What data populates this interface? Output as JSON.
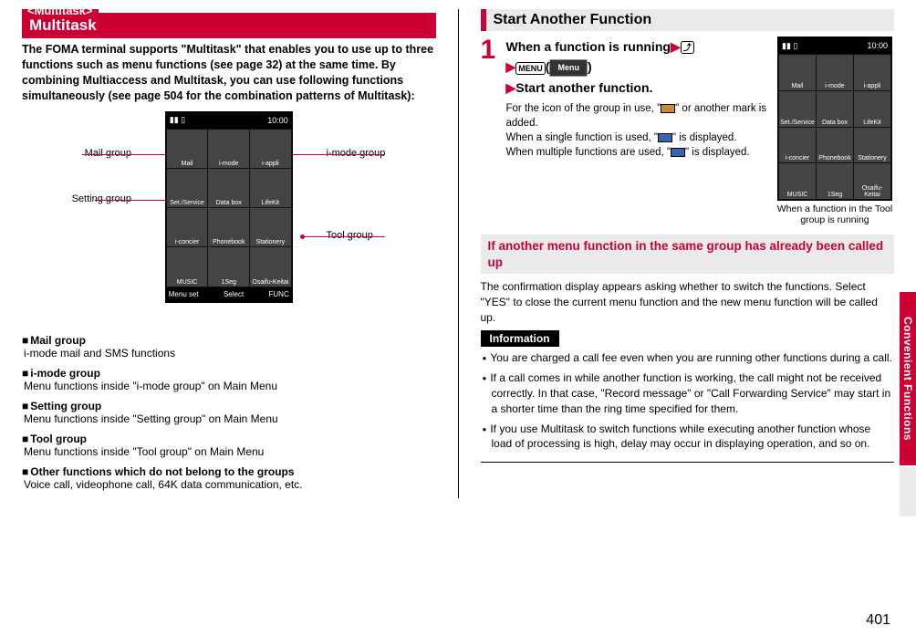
{
  "left": {
    "tag": "<Multitask>",
    "heading": "Multitask",
    "intro": "The FOMA terminal supports \"Multitask\" that enables you to use up to three functions such as menu functions (see page 32) at the same time. By combining Multiaccess and Multitask, you can use following functions simultaneously (see page 504 for the combination patterns of Multitask):",
    "labels": {
      "mail": "Mail group",
      "setting": "Setting group",
      "imode": "i-mode group",
      "tool": "Tool group"
    },
    "phone": {
      "sig": "▮▮ ▯",
      "time": "10:00",
      "cells": [
        "Mail",
        "i-mode",
        "i-appli",
        "Set./Service",
        "Data box",
        "LifeKit",
        "i-concier",
        "Phonebook",
        "Stationery",
        "MUSIC",
        "1Seg",
        "Osaifu-Keitai"
      ],
      "soft_l": "Menu set",
      "soft_c": "Select",
      "soft_r": "FUNC"
    },
    "groups": [
      {
        "title": "Mail group",
        "desc": "i-mode mail and SMS functions"
      },
      {
        "title": "i-mode group",
        "desc": "Menu functions inside \"i-mode group\" on Main Menu"
      },
      {
        "title": "Setting group",
        "desc": "Menu functions inside \"Setting group\" on Main Menu"
      },
      {
        "title": "Tool group",
        "desc": "Menu functions inside \"Tool group\" on Main Menu"
      },
      {
        "title": "Other functions which do not belong to the groups",
        "desc": "Voice call, videophone call, 64K data communication, etc."
      }
    ]
  },
  "right": {
    "heading": "Start Another Function",
    "step_num": "1",
    "step_line1_a": "When a function is running",
    "menu_key": "MENU",
    "menu_btn": "Menu",
    "step_line3": "Start another function.",
    "step_sub": {
      "l1a": "For the icon of the group in use, \"",
      "l1b": "\" or another mark is added.",
      "l2a": "When a single function is used, \"",
      "l2b": "\" is displayed.",
      "l3a": "When multiple functions are used, \"",
      "l3b": "\" is displayed."
    },
    "phone_caption": "When a function in the Tool group is running",
    "phone": {
      "sig": "▮▮ ▯",
      "time": "10:00",
      "cells": [
        "Mail",
        "i-mode",
        "i-appli",
        "Set./Service",
        "Data box",
        "LifeKit",
        "i-concier",
        "Phonebook",
        "Stationery",
        "MUSIC",
        "1Seg",
        "Osaifu-Keitai"
      ]
    },
    "sub_heading": "If another menu function in the same group has already been called up",
    "sub_para": "The confirmation display appears asking whether to switch the functions. Select \"YES\" to close the current menu function and the new menu function will be called up.",
    "info_label": "Information",
    "info_items": [
      "You are charged a call fee even when you are running other functions during a call.",
      "If a call comes in while another function is working, the call might not be received correctly. In that case, \"Record message\" or \"Call Forwarding Service\" may start in a shorter time than the ring time specified for them.",
      "If you use Multitask to switch functions while executing another function whose load of processing is high, delay may occur in displaying operation, and so on."
    ]
  },
  "side_tab": "Convenient Functions",
  "page_number": "401"
}
